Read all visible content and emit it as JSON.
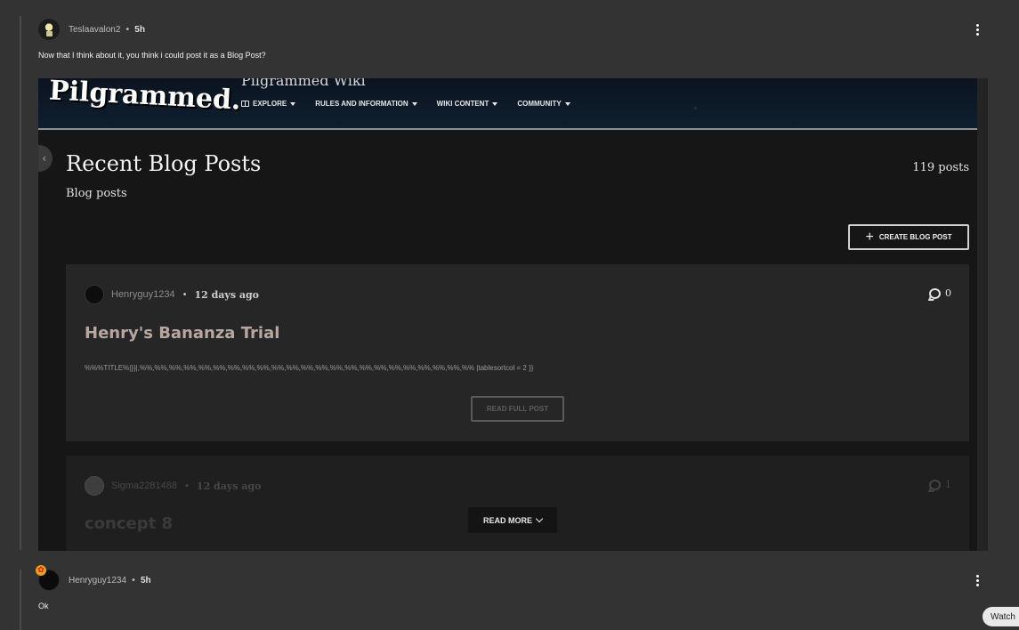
{
  "replies": [
    {
      "username": "Teslaavalon2",
      "separator": "•",
      "time": "5h",
      "text": "Now that I think about it, you think i could post it as a Blog Post?"
    },
    {
      "username": "Henryguy1234",
      "separator": "•",
      "time": "5h",
      "text": "Ok"
    }
  ],
  "screenshot": {
    "logo": "Pilgrammed.",
    "wiki_name": "Pilgrammed Wiki",
    "nav": [
      {
        "label": "EXPLORE"
      },
      {
        "label": "RULES AND INFORMATION"
      },
      {
        "label": "WIKI CONTENT"
      },
      {
        "label": "COMMUNITY"
      }
    ],
    "page_title": "Recent Blog Posts",
    "page_subtitle": "Blog posts",
    "post_count": "119 posts",
    "create_button": "CREATE BLOG POST",
    "posts": [
      {
        "author": "Henryguy1234",
        "separator": "•",
        "time": "12 days ago",
        "comments": "0",
        "title": "Henry's Bananza Trial",
        "excerpt": "%%%TITLE%|}}|,%%,%%,%%,%%,%%,%%,%%,%%,%%,%%,%%,%%,%%,%%,%%,%%,%%,%%,%%,%%,%%,%%,%% |tablesortcol = 2 }}",
        "read_label": "READ FULL POST"
      },
      {
        "author": "Sigma2281488",
        "separator": "•",
        "time": "12 days ago",
        "comments": "1",
        "title": "concept 8"
      }
    ],
    "read_more": "READ MORE"
  },
  "watch_button": "Watch"
}
